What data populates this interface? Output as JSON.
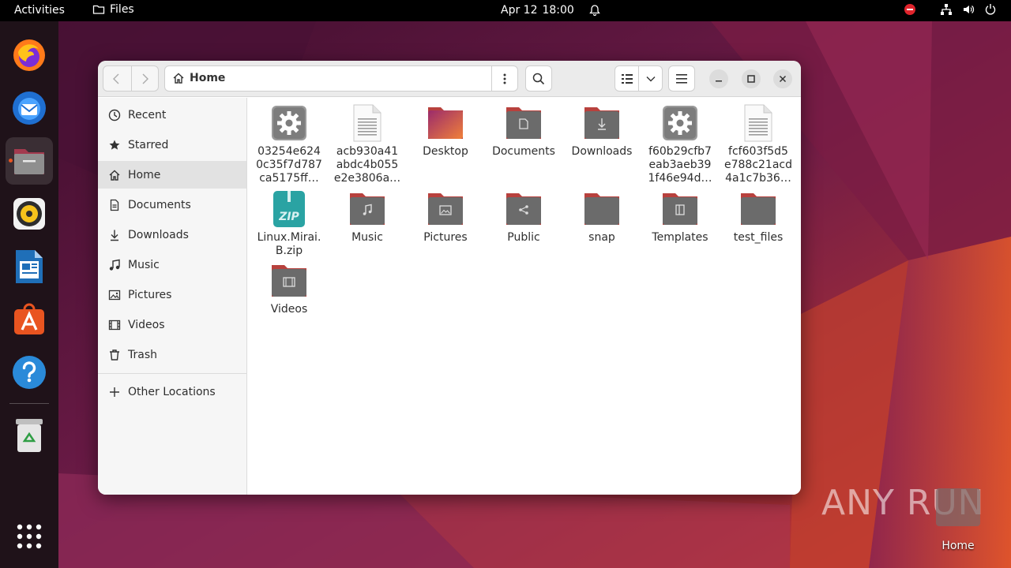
{
  "topbar": {
    "activities": "Activities",
    "app_name": "Files",
    "date": "Apr 12",
    "time": "18:00"
  },
  "dock": {
    "items": [
      "firefox-icon",
      "thunderbird-icon",
      "files-icon",
      "rhythmbox-icon",
      "libreoffice-writer-icon",
      "app-center-icon",
      "help-icon",
      "trash-icon",
      "show-apps-icon"
    ],
    "active": "files-icon"
  },
  "window": {
    "path": "Home"
  },
  "sidebar": {
    "items": [
      {
        "label": "Recent",
        "icon": "clock-icon"
      },
      {
        "label": "Starred",
        "icon": "star-icon"
      },
      {
        "label": "Home",
        "icon": "home-icon",
        "active": true
      },
      {
        "label": "Documents",
        "icon": "document-icon"
      },
      {
        "label": "Downloads",
        "icon": "download-icon"
      },
      {
        "label": "Music",
        "icon": "music-icon"
      },
      {
        "label": "Pictures",
        "icon": "picture-icon"
      },
      {
        "label": "Videos",
        "icon": "video-icon"
      },
      {
        "label": "Trash",
        "icon": "trash-icon"
      }
    ],
    "other_locations": "Other Locations"
  },
  "files": [
    {
      "name": "03254e6240c35f7d787ca5175ff…",
      "lines": [
        "03254e624",
        "0c35f7d787",
        "ca5175ff…"
      ],
      "kind": "executable"
    },
    {
      "name": "acb930a41abdc4b055e2e3806a…",
      "lines": [
        "acb930a41",
        "abdc4b055",
        "e2e3806a…"
      ],
      "kind": "text"
    },
    {
      "name": "Desktop",
      "lines": [
        "Desktop"
      ],
      "kind": "folder-desktop"
    },
    {
      "name": "Documents",
      "lines": [
        "Documents"
      ],
      "kind": "folder-documents"
    },
    {
      "name": "Downloads",
      "lines": [
        "Downloads"
      ],
      "kind": "folder-downloads"
    },
    {
      "name": "f60b29cfb7eab3aeb391f46e94d…",
      "lines": [
        "f60b29cfb7",
        "eab3aeb39",
        "1f46e94d…"
      ],
      "kind": "executable"
    },
    {
      "name": "fcf603f5d5e788c21acd4a1c7b36…",
      "lines": [
        "fcf603f5d5",
        "e788c21acd",
        "4a1c7b36…"
      ],
      "kind": "text"
    },
    {
      "name": "Linux.Mirai.B.zip",
      "lines": [
        "Linux.Mirai.",
        "B.zip"
      ],
      "kind": "zip"
    },
    {
      "name": "Music",
      "lines": [
        "Music"
      ],
      "kind": "folder-music"
    },
    {
      "name": "Pictures",
      "lines": [
        "Pictures"
      ],
      "kind": "folder-pictures"
    },
    {
      "name": "Public",
      "lines": [
        "Public"
      ],
      "kind": "folder-public"
    },
    {
      "name": "snap",
      "lines": [
        "snap"
      ],
      "kind": "folder"
    },
    {
      "name": "Templates",
      "lines": [
        "Templates"
      ],
      "kind": "folder-templates"
    },
    {
      "name": "test_files",
      "lines": [
        "test_files"
      ],
      "kind": "folder"
    },
    {
      "name": "Videos",
      "lines": [
        "Videos"
      ],
      "kind": "folder-videos"
    }
  ],
  "desktop": {
    "home_label": "Home",
    "watermark": "ANY RUN"
  },
  "colors": {
    "accent": "#e95420",
    "folder": "#6b6b6b",
    "folder_tab": "#b8413d"
  }
}
